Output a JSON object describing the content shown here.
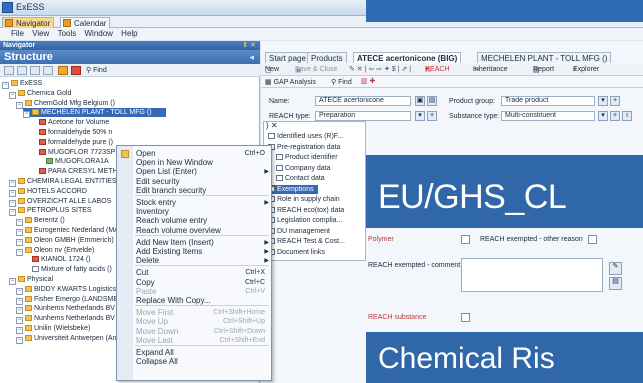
{
  "window": {
    "app_title": "ExESS"
  },
  "doc_tabs": [
    {
      "label": "Navigator",
      "active": true
    },
    {
      "label": "Calendar",
      "active": false
    }
  ],
  "menubar": [
    "File",
    "View",
    "Tools",
    "Window",
    "Help"
  ],
  "navigator": {
    "header": "Navigator",
    "structure_title": "Structure",
    "find_label": "Find"
  },
  "tree": [
    {
      "label": "ExESS",
      "level": 0,
      "icon": "folder"
    },
    {
      "label": "Chemica Gold",
      "level": 1,
      "icon": "folder"
    },
    {
      "label": "ChemGold Mfg Belgium ()",
      "level": 2,
      "icon": "folder"
    },
    {
      "label": "MECHELEN PLANT - TOLL MFG ()",
      "level": 3,
      "icon": "folder",
      "selected": true
    },
    {
      "label": "Acetone for Volume",
      "level": 4,
      "icon": "mol"
    },
    {
      "label": "formaldehyde 50% n",
      "level": 4,
      "icon": "mol"
    },
    {
      "label": "formaldehyde pure ()",
      "level": 4,
      "icon": "mol"
    },
    {
      "label": "MUGOFLOR 7723SP",
      "level": 4,
      "icon": "mol"
    },
    {
      "label": "MUGOFLORA1A",
      "level": 5,
      "icon": "sub"
    },
    {
      "label": "PARA CRESYL METH",
      "level": 4,
      "icon": "mol"
    },
    {
      "label": "CHEMIRA LEGAL ENTITIES",
      "level": 1,
      "icon": "folder"
    },
    {
      "label": "HOTELS ACCORD",
      "level": 1,
      "icon": "folder"
    },
    {
      "label": "OVERZICHT ALLE LABOS",
      "level": 1,
      "icon": "folder"
    },
    {
      "label": "PETROPLUS SITES",
      "level": 1,
      "icon": "folder"
    },
    {
      "label": "Berentz ()",
      "level": 2,
      "icon": "folder"
    },
    {
      "label": "Eurogentec Nederland (MA",
      "level": 2,
      "icon": "folder"
    },
    {
      "label": "Oleon GMBH (Emmerich)",
      "level": 2,
      "icon": "folder"
    },
    {
      "label": "Oleon nv (Ertvelde)",
      "level": 2,
      "icon": "folder"
    },
    {
      "label": "KIANOL 1724 ()",
      "level": 3,
      "icon": "mol"
    },
    {
      "label": "Mixture of fatty acids ()",
      "level": 3,
      "icon": "doc"
    },
    {
      "label": "Physical",
      "level": 1,
      "icon": "folder"
    },
    {
      "label": "BIDDY KWARTS Logistics (",
      "level": 2,
      "icon": "folder"
    },
    {
      "label": "Fisher Emergo (LANDSMEE",
      "level": 2,
      "icon": "folder"
    },
    {
      "label": "Nunhems Netherlands BV (",
      "level": 2,
      "icon": "folder"
    },
    {
      "label": "Nunhems Netherlands BV (",
      "level": 2,
      "icon": "folder"
    },
    {
      "label": "Unilin (Wielsbeke)",
      "level": 2,
      "icon": "folder"
    },
    {
      "label": "Universiteit Antwerpen (An",
      "level": 2,
      "icon": "folder"
    }
  ],
  "context_menu": [
    {
      "label": "Open",
      "shortcut": "Ctrl+O",
      "icon": "open-icon"
    },
    {
      "label": "Open in New Window",
      "shortcut": ""
    },
    {
      "label": "Open List (Enter)",
      "shortcut": "",
      "arrow": true
    },
    {
      "label": "Edit security",
      "shortcut": ""
    },
    {
      "label": "Edit branch security",
      "shortcut": ""
    },
    {
      "sep": true
    },
    {
      "label": "Stock entry",
      "shortcut": "",
      "arrow": true
    },
    {
      "label": "Inventory",
      "shortcut": ""
    },
    {
      "label": "Reach volume entry",
      "shortcut": ""
    },
    {
      "label": "Reach volume overview",
      "shortcut": ""
    },
    {
      "sep": true
    },
    {
      "label": "Add New Item (Insert)",
      "shortcut": "",
      "arrow": true
    },
    {
      "label": "Add Existing Items",
      "shortcut": "",
      "arrow": true
    },
    {
      "label": "Delete",
      "shortcut": "",
      "arrow": true
    },
    {
      "sep": true
    },
    {
      "label": "Cut",
      "shortcut": "Ctrl+X"
    },
    {
      "label": "Copy",
      "shortcut": "Ctrl+C"
    },
    {
      "label": "Paste",
      "shortcut": "Ctrl+V",
      "disabled": true
    },
    {
      "label": "Replace With Copy...",
      "shortcut": ""
    },
    {
      "sep": true
    },
    {
      "label": "Move First",
      "shortcut": "Ctrl+Shift+Home",
      "disabled": true
    },
    {
      "label": "Move Up",
      "shortcut": "Ctrl+Shift+Up",
      "disabled": true
    },
    {
      "label": "Move Down",
      "shortcut": "Ctrl+Shift+Down",
      "disabled": true
    },
    {
      "label": "Move Last",
      "shortcut": "Ctrl+Shift+End",
      "disabled": true
    },
    {
      "sep": true
    },
    {
      "label": "Expand All",
      "shortcut": ""
    },
    {
      "label": "Collapse All",
      "shortcut": ""
    }
  ],
  "right_tabs": [
    {
      "label": "Start page",
      "active": false
    },
    {
      "label": "Products",
      "active": false
    },
    {
      "label": "ATECE acertonicone (BIG)",
      "active": true
    },
    {
      "label": "MECHELEN PLANT - TOLL MFG ()",
      "active": false
    }
  ],
  "right_toolbar": {
    "new": "New",
    "save_close": "Save & Close",
    "reach": "REACH",
    "inheritance": "Inheritance",
    "report": "Report",
    "explorer": "Explorer",
    "gap": "GAP Analysis",
    "find": "Find"
  },
  "form": {
    "name_label": "Name:",
    "name_value": "ATECE acertonicone",
    "product_group_label": "Product group:",
    "product_group_value": "Trade product",
    "reach_type_label": "REACH type:",
    "reach_type_value": "Preparation",
    "substance_type_label": "Substance type:",
    "substance_type_value": "Multi-constituent"
  },
  "subtree": [
    {
      "label": "Identified uses (R)F...",
      "selected": false
    },
    {
      "label": "Pre-registration data",
      "selected": false
    },
    {
      "label": "Product identifier",
      "selected": false
    },
    {
      "label": "Company data",
      "selected": false
    },
    {
      "label": "Contact data",
      "selected": false
    },
    {
      "label": "Exemptions",
      "selected": true
    },
    {
      "label": "Role in supply chain",
      "selected": false
    },
    {
      "label": "REACH eco(tox) data",
      "selected": false
    },
    {
      "label": "Legislation complia...",
      "selected": false
    },
    {
      "label": "DU management",
      "selected": false
    },
    {
      "label": "REACH Test & Cost...",
      "selected": false
    },
    {
      "label": "Document links",
      "selected": false
    }
  ],
  "exemptions": {
    "polymer": "Polymer",
    "reach_exempted_other": "REACH exempted - other reason",
    "reach_exempted_comment": "REACH exempted - comment:",
    "reach_substance": "REACH substance"
  },
  "overlay": {
    "eu_ghs": "EU/GHS_CL",
    "chemical_risk": "Chemical Ris"
  }
}
